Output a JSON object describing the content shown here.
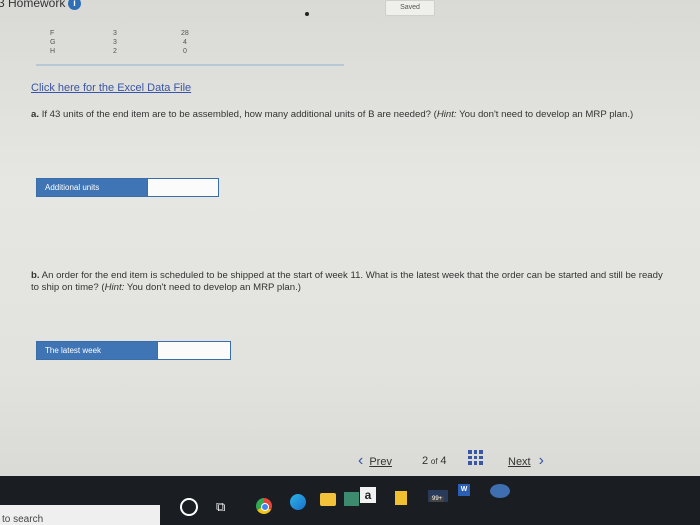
{
  "header": {
    "title": "3 Homework",
    "info_icon": "i",
    "saved_label": "Saved"
  },
  "table": {
    "rows": [
      {
        "item": "F",
        "lead": "3",
        "qty": "28"
      },
      {
        "item": "G",
        "lead": "3",
        "qty": "4"
      },
      {
        "item": "H",
        "lead": "2",
        "qty": "0"
      }
    ]
  },
  "excel_link": "Click here for the Excel Data File",
  "question_a": {
    "prefix": "a.",
    "text": "If 43 units of the end item are to be assembled, how many additional units of B are needed? (",
    "hint_label": "Hint:",
    "hint": " You don't need to develop an MRP plan.)",
    "answer_label": "Additional units",
    "answer_value": ""
  },
  "question_b": {
    "prefix": "b.",
    "text": "An order for the end item is scheduled to be shipped at the start of week 11. What is the latest week that the order can be started and still be ready to ship on time? (",
    "hint_label": "Hint:",
    "hint": " You don't need to develop an MRP plan.)",
    "answer_label": "The latest week",
    "answer_value": ""
  },
  "pager": {
    "prev_label": "Prev",
    "prev_icon": "‹",
    "page_current": "2",
    "page_of": "of",
    "page_total": "4",
    "next_label": "Next",
    "next_icon": "›"
  },
  "taskbar": {
    "search_text": "to search",
    "amazon_letter": "a",
    "mail_badge": "99+",
    "word_letter": "W"
  }
}
